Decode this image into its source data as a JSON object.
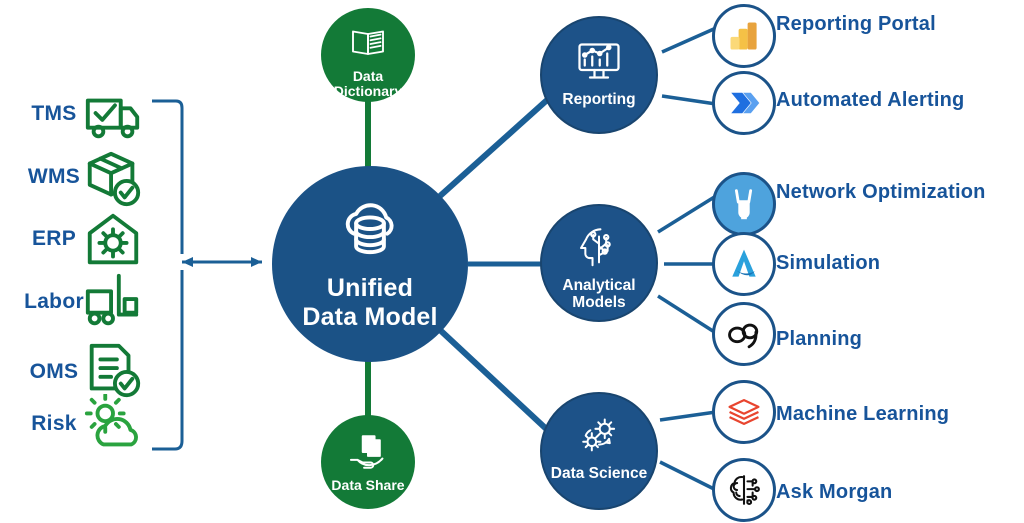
{
  "theme": {
    "hub_blue": "#1b5286",
    "node_blue": "#1d5288",
    "green": "#137a37",
    "label_blue": "#17549a",
    "wire_blue": "#1b5f96",
    "white": "#ffffff"
  },
  "sources": {
    "group_name": "source-systems",
    "items": [
      {
        "label": "TMS",
        "icon": "truck-check-icon"
      },
      {
        "label": "WMS",
        "icon": "box-check-icon"
      },
      {
        "label": "ERP",
        "icon": "warehouse-gear-icon"
      },
      {
        "label": "Labor",
        "icon": "forklift-icon"
      },
      {
        "label": "OMS",
        "icon": "order-document-check-icon"
      },
      {
        "label": "Risk",
        "icon": "sun-cloud-icon"
      }
    ]
  },
  "hub": {
    "title_line1": "Unified",
    "title_line2": "Data Model",
    "icon": "cloud-database-icon"
  },
  "governance": [
    {
      "name": "data-dictionary",
      "label_line1": "Data",
      "label_line2": "Dictionary",
      "icon": "open-book-icon",
      "position": "top"
    },
    {
      "name": "data-share",
      "label_line1": "Data Share",
      "label_line2": "",
      "icon": "hand-documents-icon",
      "position": "bottom"
    }
  ],
  "capabilities": [
    {
      "name": "reporting",
      "label_line1": "Reporting",
      "label_line2": "",
      "icon": "monitor-chart-icon",
      "leaves": [
        {
          "label": "Reporting Portal",
          "icon": "power-bi-icon"
        },
        {
          "label": "Automated Alerting",
          "icon": "power-automate-icon"
        }
      ]
    },
    {
      "name": "analytical-models",
      "label_line1": "Analytical",
      "label_line2": "Models",
      "icon": "head-circuit-icon",
      "leaves": [
        {
          "label": "Network Optimization",
          "icon": "llamasoft-icon"
        },
        {
          "label": "Simulation",
          "icon": "anylogic-icon"
        },
        {
          "label": "Planning",
          "icon": "o9-icon"
        }
      ]
    },
    {
      "name": "data-science",
      "label_line1": "Data Science",
      "label_line2": "",
      "icon": "gears-icon",
      "leaves": [
        {
          "label": "Machine Learning",
          "icon": "databricks-layers-icon"
        },
        {
          "label": "Ask Morgan",
          "icon": "brain-circuit-icon"
        }
      ]
    }
  ]
}
